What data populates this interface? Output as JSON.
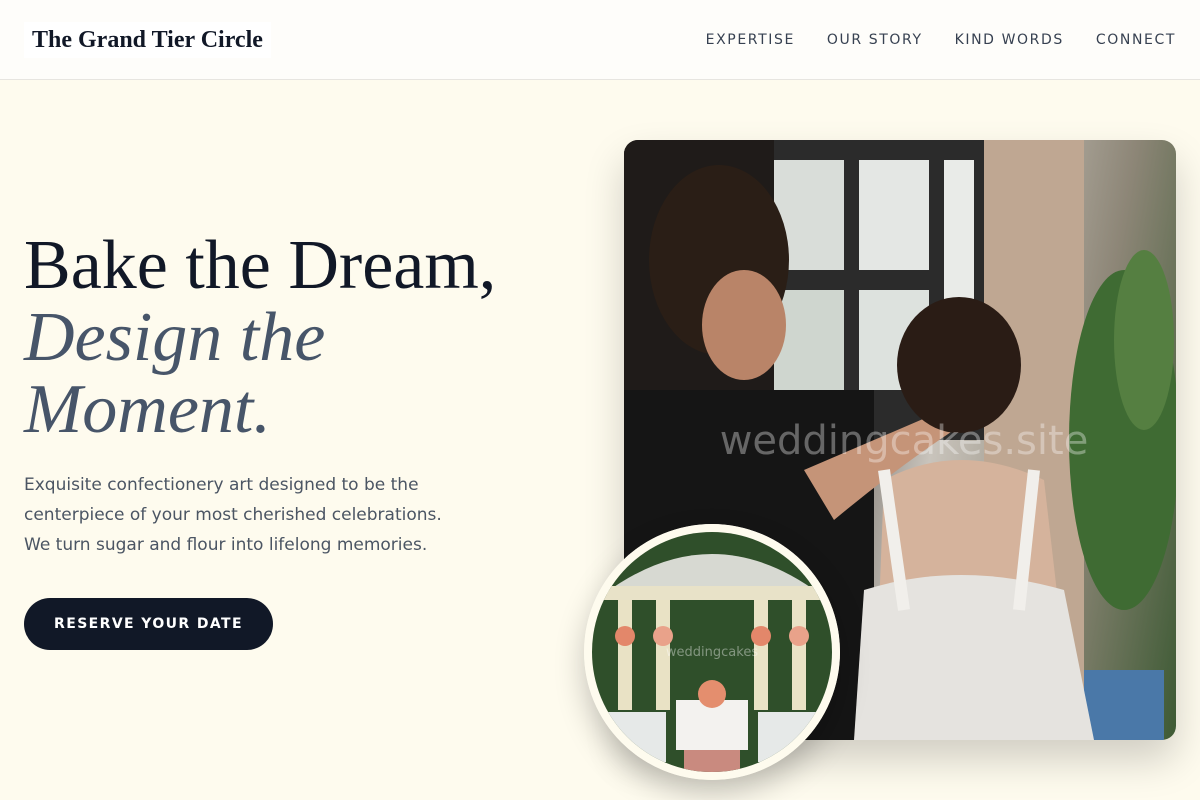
{
  "brand": {
    "name": "The Grand Tier Circle"
  },
  "nav": {
    "items": [
      {
        "label": "EXPERTISE"
      },
      {
        "label": "OUR STORY"
      },
      {
        "label": "KIND WORDS"
      },
      {
        "label": "CONNECT"
      }
    ]
  },
  "hero": {
    "title_line1": "Bake the Dream,",
    "title_line2": "Design the",
    "title_line3": "Moment.",
    "subtitle": "Exquisite confectionery art designed to be the centerpiece of your most cherished celebrations. We turn sugar and flour into lifelong memories.",
    "cta_label": "RESERVE YOUR DATE"
  },
  "media": {
    "main_watermark": "weddingcakes.site",
    "inset_watermark": "weddingcakes"
  },
  "colors": {
    "page_background": "#fefbee",
    "navy": "#111827",
    "slate": "#475569",
    "body_text": "#4b5563"
  }
}
